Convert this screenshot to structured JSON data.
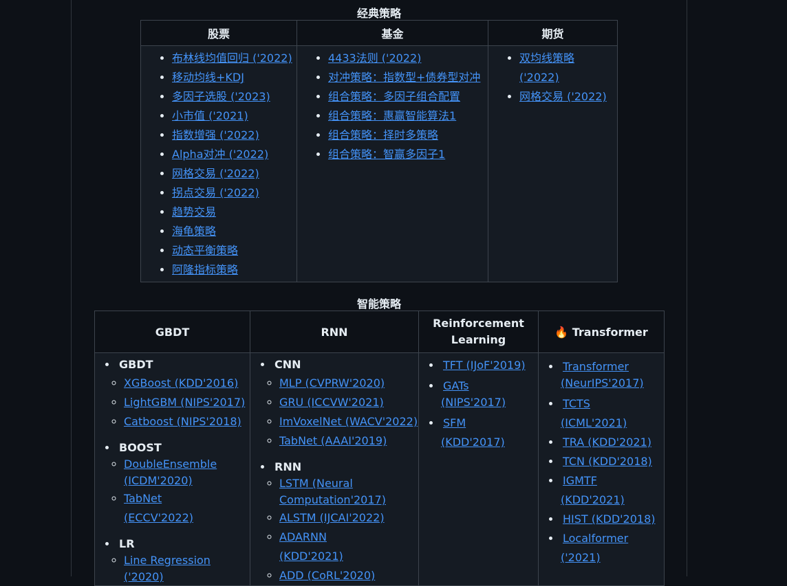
{
  "classic": {
    "title": "经典策略",
    "headers": [
      "股票",
      "基金",
      "期货"
    ],
    "stocks": [
      "布林线均值回归 ('2022)",
      "移动均线+KDJ",
      "多因子选股 ('2023)",
      "小市值 ('2021)",
      "指数增强 ('2022)",
      "Alpha对冲 ('2022)",
      "网格交易 ('2022)",
      "拐点交易 ('2022)",
      "趋势交易",
      "海龟策略",
      "动态平衡策略",
      "阿隆指标策略"
    ],
    "funds": [
      "4433法则 ('2022)",
      "对冲策略：指数型+债券型对冲",
      "组合策略：多因子组合配置",
      "组合策略：惠赢智能算法1",
      "组合策略：择时多策略",
      "组合策略：智赢多因子1"
    ],
    "futures": [
      "双均线策略 ('2022)",
      "网格交易 ('2022)"
    ]
  },
  "ai": {
    "title": "智能策略",
    "headers": {
      "gbdt": "GBDT",
      "rnn": "RNN",
      "rl": "Reinforcement Learning",
      "transformer_icon": "🔥",
      "transformer": "Transformer"
    },
    "gbdt_col": {
      "g1": "GBDT",
      "g1_items": [
        "XGBoost (KDD'2016)",
        "LightGBM (NIPS'2017)",
        "Catboost (NIPS'2018)"
      ],
      "g2": "BOOST",
      "g2_items": [
        "DoubleEnsemble (ICDM'2020)",
        "TabNet (ECCV'2022)"
      ],
      "g3": "LR",
      "g3_items": [
        "Line Regression ('2020)"
      ]
    },
    "rnn_col": {
      "g1": "CNN",
      "g1_items": [
        "MLP (CVPRW'2020)",
        "GRU (ICCVW'2021)",
        "ImVoxelNet (WACV'2022)",
        "TabNet (AAAI'2019)"
      ],
      "g2": "RNN",
      "g2_items": [
        "LSTM (Neural Computation'2017)",
        "ALSTM (IJCAI'2022)",
        "ADARNN (KDD'2021)",
        "ADD (CoRL'2020)"
      ]
    },
    "rl_col": [
      "TFT (IJoF'2019)",
      "GATs (NIPS'2017)",
      "SFM (KDD'2017)"
    ],
    "transformer_col": [
      "Transformer (NeurIPS'2017)",
      "TCTS (ICML'2021)",
      "TRA (KDD'2021)",
      "TCN (KDD'2018)",
      "IGMTF (KDD'2021)",
      "HIST (KDD'2018)",
      "Localformer ('2021)"
    ]
  }
}
